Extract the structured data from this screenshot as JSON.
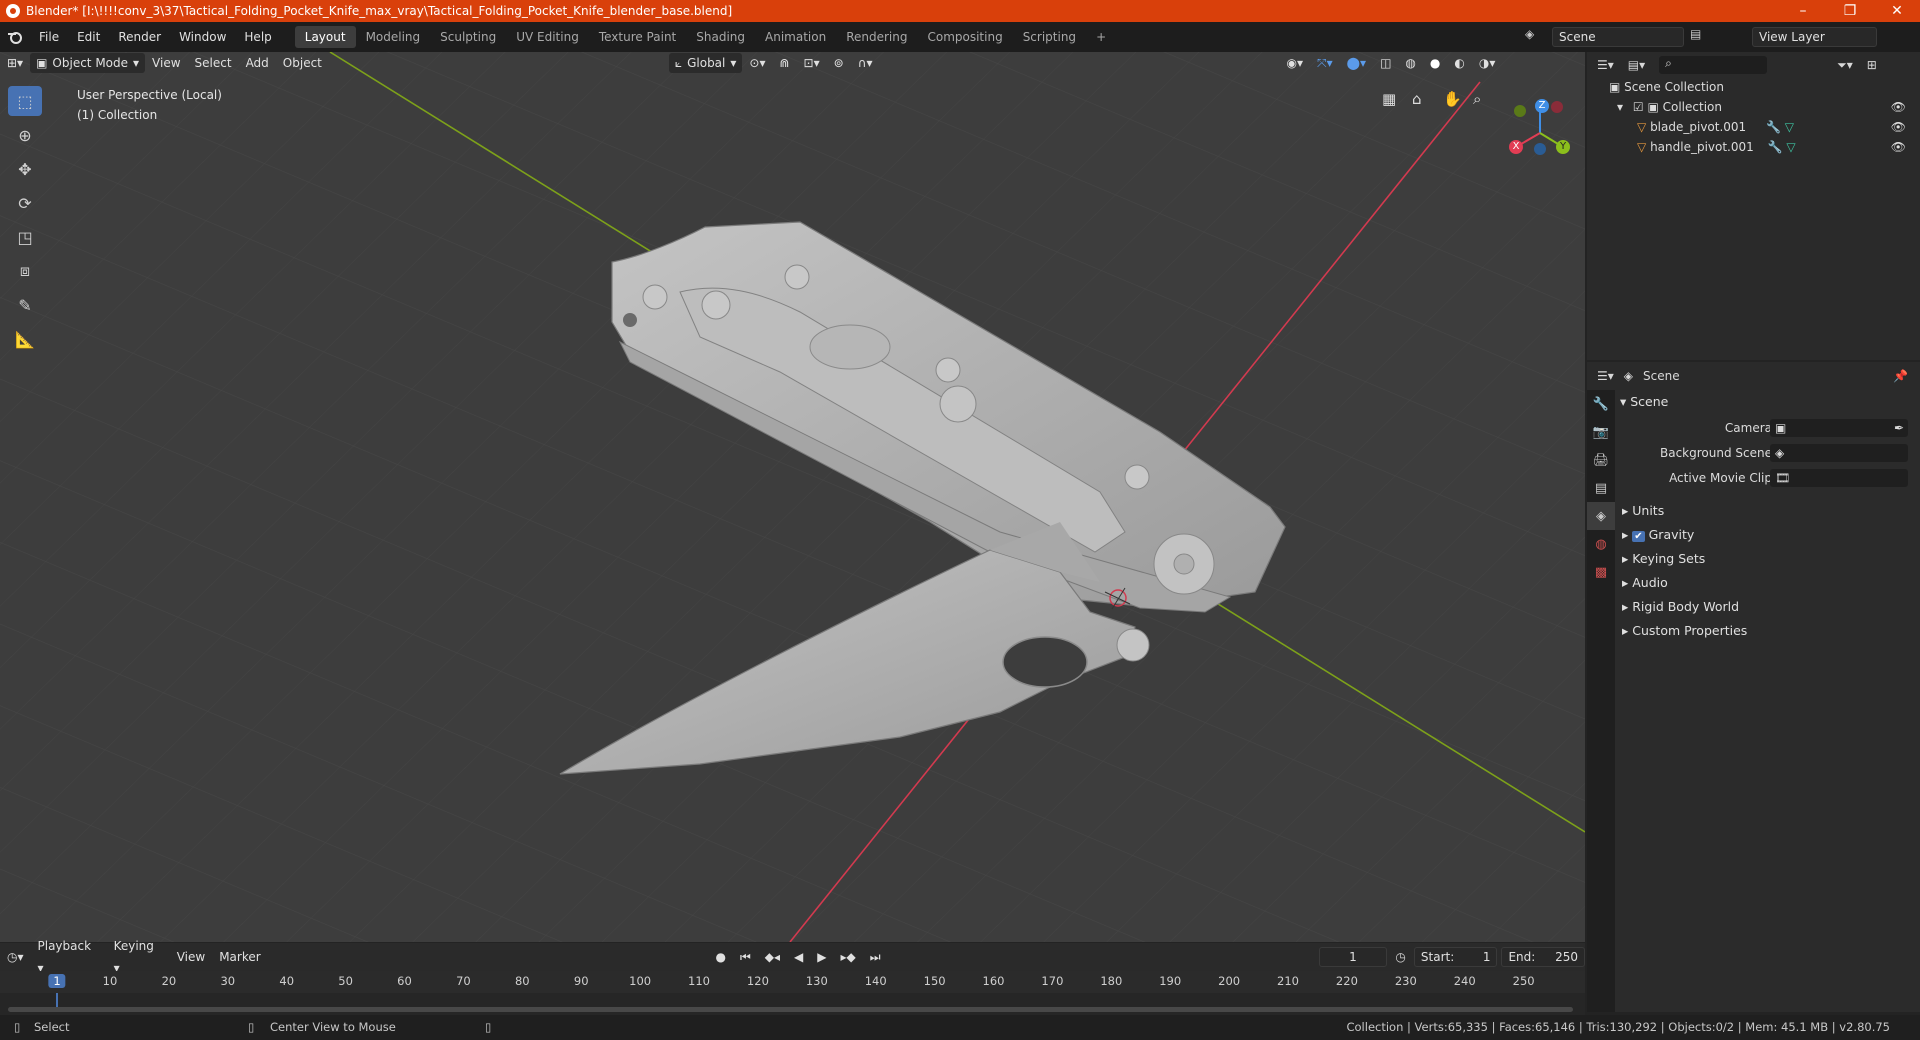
{
  "window": {
    "title": "Blender* [I:\\!!!!conv_3\\37\\Tactical_Folding_Pocket_Knife_max_vray\\Tactical_Folding_Pocket_Knife_blender_base.blend]",
    "minimize": "–",
    "maximize": "❐",
    "close": "✕"
  },
  "menu": [
    "File",
    "Edit",
    "Render",
    "Window",
    "Help"
  ],
  "workspaces": [
    "Layout",
    "Modeling",
    "Sculpting",
    "UV Editing",
    "Texture Paint",
    "Shading",
    "Animation",
    "Rendering",
    "Compositing",
    "Scripting"
  ],
  "active_workspace": "Layout",
  "add_workspace": "+",
  "scene_field": "Scene",
  "view_layer_field": "View Layer",
  "viewport": {
    "mode": "Object Mode",
    "menus": [
      "View",
      "Select",
      "Add",
      "Object"
    ],
    "orientation": "Global",
    "perspective_label": "User Perspective (Local)",
    "collection_label": "(1) Collection",
    "gizmo": {
      "x": "X",
      "y": "Y",
      "z": "Z"
    }
  },
  "outliner": {
    "root": "Scene Collection",
    "collection": "Collection",
    "objects": [
      "blade_pivot.001",
      "handle_pivot.001"
    ]
  },
  "properties": {
    "header": "Scene",
    "panel_title": "Scene",
    "camera_label": "Camera",
    "background_scene_label": "Background Scene",
    "active_movie_clip_label": "Active Movie Clip",
    "sections": [
      "Units",
      "Gravity",
      "Keying Sets",
      "Audio",
      "Rigid Body World",
      "Custom Properties"
    ],
    "gravity_checked": true
  },
  "timeline": {
    "menus": [
      "Playback",
      "Keying",
      "View",
      "Marker"
    ],
    "current_frame": "1",
    "start_label": "Start:",
    "start": "1",
    "end_label": "End:",
    "end": "250",
    "ticks": [
      "1",
      "10",
      "20",
      "30",
      "40",
      "50",
      "60",
      "70",
      "80",
      "90",
      "100",
      "110",
      "120",
      "130",
      "140",
      "150",
      "160",
      "170",
      "180",
      "190",
      "200",
      "210",
      "220",
      "230",
      "240",
      "250"
    ]
  },
  "status": {
    "left_action": "Select",
    "mid_action": "Center View to Mouse",
    "stats": "Collection | Verts:65,335 | Faces:65,146 | Tris:130,292 | Objects:0/2 | Mem: 45.1 MB | v2.80.75"
  },
  "colors": {
    "titlebar": "#d9400b",
    "accent": "#4772b3",
    "x_axis": "#e23d54",
    "y_axis": "#8bbe1c",
    "z_axis": "#3f8ee6"
  }
}
